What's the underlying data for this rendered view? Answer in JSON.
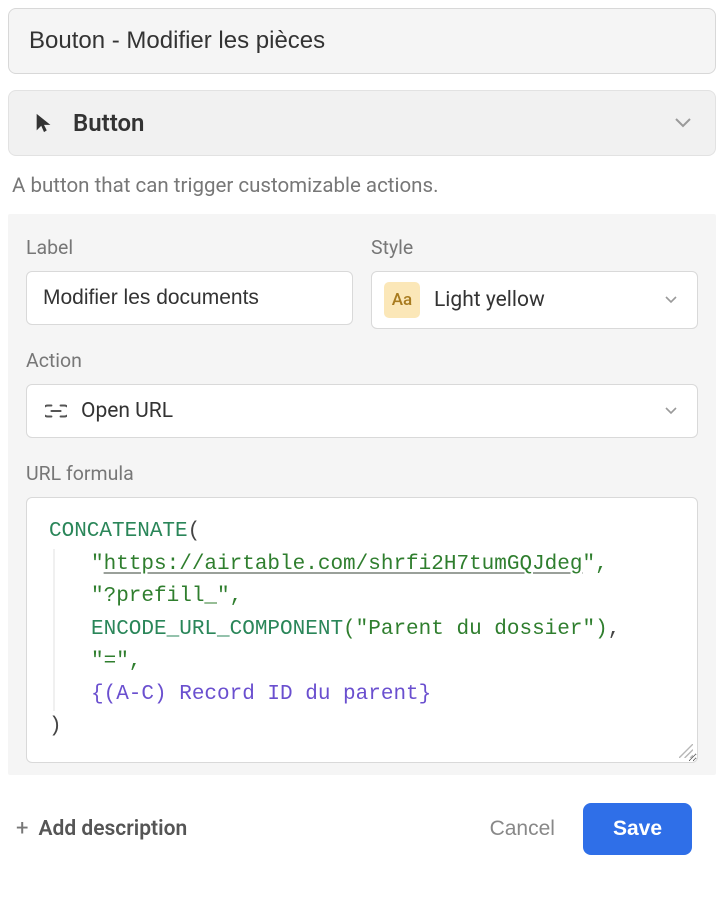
{
  "field_name": "Bouton - Modifier les pièces",
  "type": {
    "label": "Button",
    "description": "A button that can trigger customizable actions."
  },
  "form": {
    "label_section_title": "Label",
    "label_value": "Modifier les documents",
    "style_section_title": "Style",
    "style_swatch_text": "Aa",
    "style_value": "Light yellow",
    "action_section_title": "Action",
    "action_value": "Open URL",
    "url_formula_title": "URL formula"
  },
  "formula": {
    "fn1": "CONCATENATE",
    "open": "(",
    "line1_prefix": "\"",
    "line1_url": "https://airtable.com/shrfi2H7tumGQJdeg",
    "line1_suffix": "\",",
    "line2": "\"?prefill_\",",
    "fn2": "ENCODE_URL_COMPONENT",
    "line3_arg": "(\"Parent du dossier\")",
    "line3_comma": ",",
    "line4": "\"=\",",
    "line5_ref": "{(A-C) Record ID du parent}",
    "close": ")"
  },
  "footer": {
    "add_description": "Add description",
    "cancel": "Cancel",
    "save": "Save"
  }
}
